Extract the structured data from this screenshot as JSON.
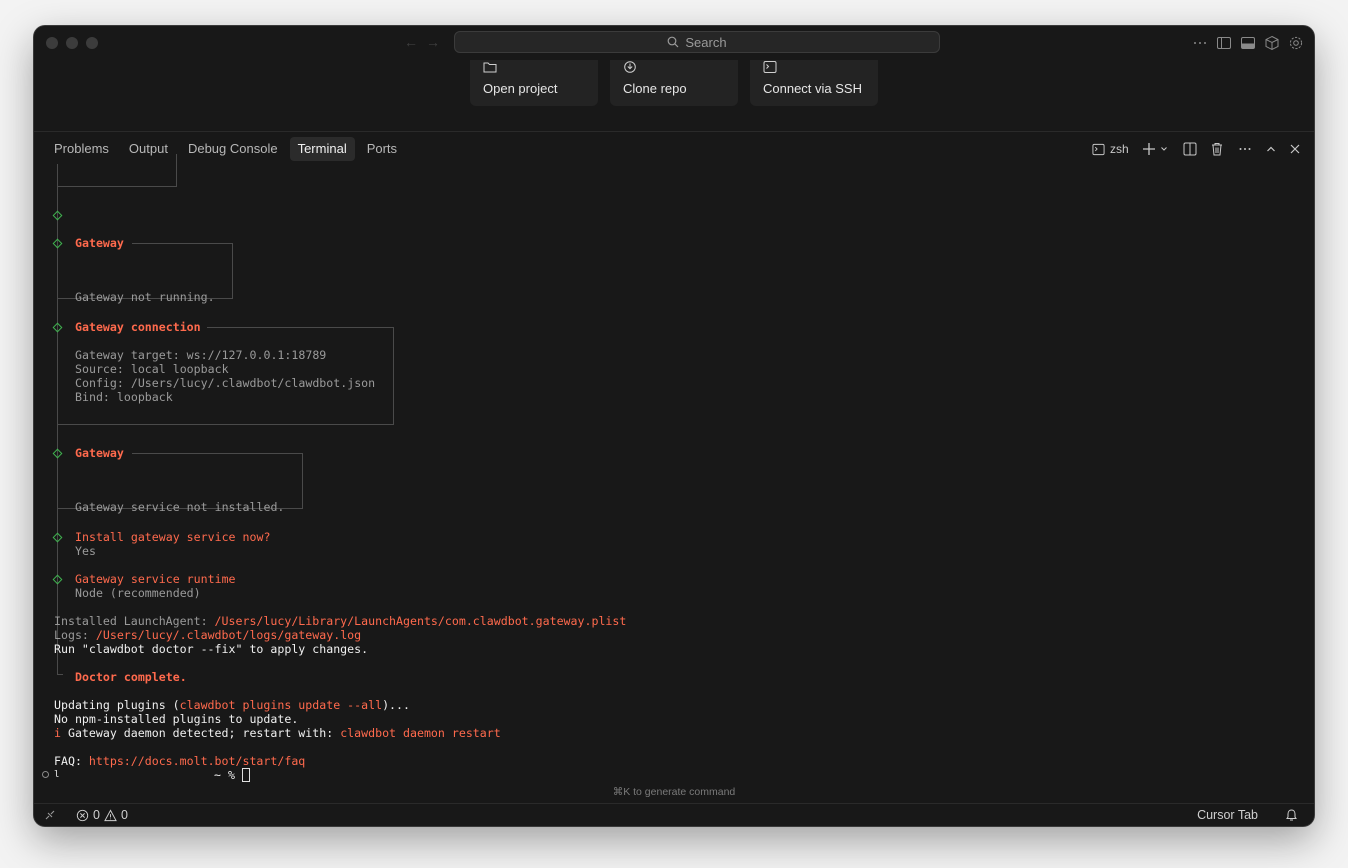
{
  "toolbar": {
    "search_label": "Search"
  },
  "quick_actions": [
    {
      "label": "Open project",
      "icon": "folder-icon"
    },
    {
      "label": "Clone repo",
      "icon": "clone-icon"
    },
    {
      "label": "Connect via SSH",
      "icon": "terminal-icon"
    }
  ],
  "panel": {
    "tabs": [
      "Problems",
      "Output",
      "Debug Console",
      "Terminal",
      "Ports"
    ],
    "active_tab": "Terminal",
    "shell_label": "zsh"
  },
  "terminal": {
    "block1_title": "Gateway",
    "block1_body": "Gateway not running.",
    "block2_title": "Gateway connection",
    "block2_lines": [
      "Gateway target: ws://127.0.0.1:18789",
      "Source: local loopback",
      "Config: /Users/lucy/.clawdbot/clawdbot.json",
      "Bind: loopback"
    ],
    "block3_title": "Gateway",
    "block3_body": "Gateway service not installed.",
    "q1_title": "Install gateway service now?",
    "q1_answer": "Yes",
    "q2_title": "Gateway service runtime",
    "q2_answer": "Node (recommended)",
    "launch_prefix": "Installed LaunchAgent: ",
    "launch_path": "/Users/lucy/Library/LaunchAgents/com.clawdbot.gateway.plist",
    "logs_prefix": "Logs: ",
    "logs_path": "/Users/lucy/.clawdbot/logs/gateway.log",
    "run_line": "Run \"clawdbot doctor --fix\" to apply changes.",
    "doctor_done": "Doctor complete.",
    "update_prefix": "Updating plugins (",
    "update_cmd": "clawdbot plugins update --all",
    "update_suffix": ")...",
    "no_plugins": "No npm-installed plugins to update.",
    "info_mark": "i",
    "daemon_text": " Gateway daemon detected; restart with: ",
    "daemon_cmd": "clawdbot daemon restart",
    "faq_prefix": "FAQ: ",
    "faq_url": "https://docs.molt.bot/start/faq",
    "prompt_left": "l",
    "prompt": "~ %",
    "hint": "⌘K to generate command"
  },
  "statusbar": {
    "errors": "0",
    "warnings": "0",
    "cursor_tab": "Cursor Tab"
  },
  "colors": {
    "accent_red": "#ff6a4d",
    "diamond_green": "#3fb24f",
    "window_bg": "#181818"
  }
}
